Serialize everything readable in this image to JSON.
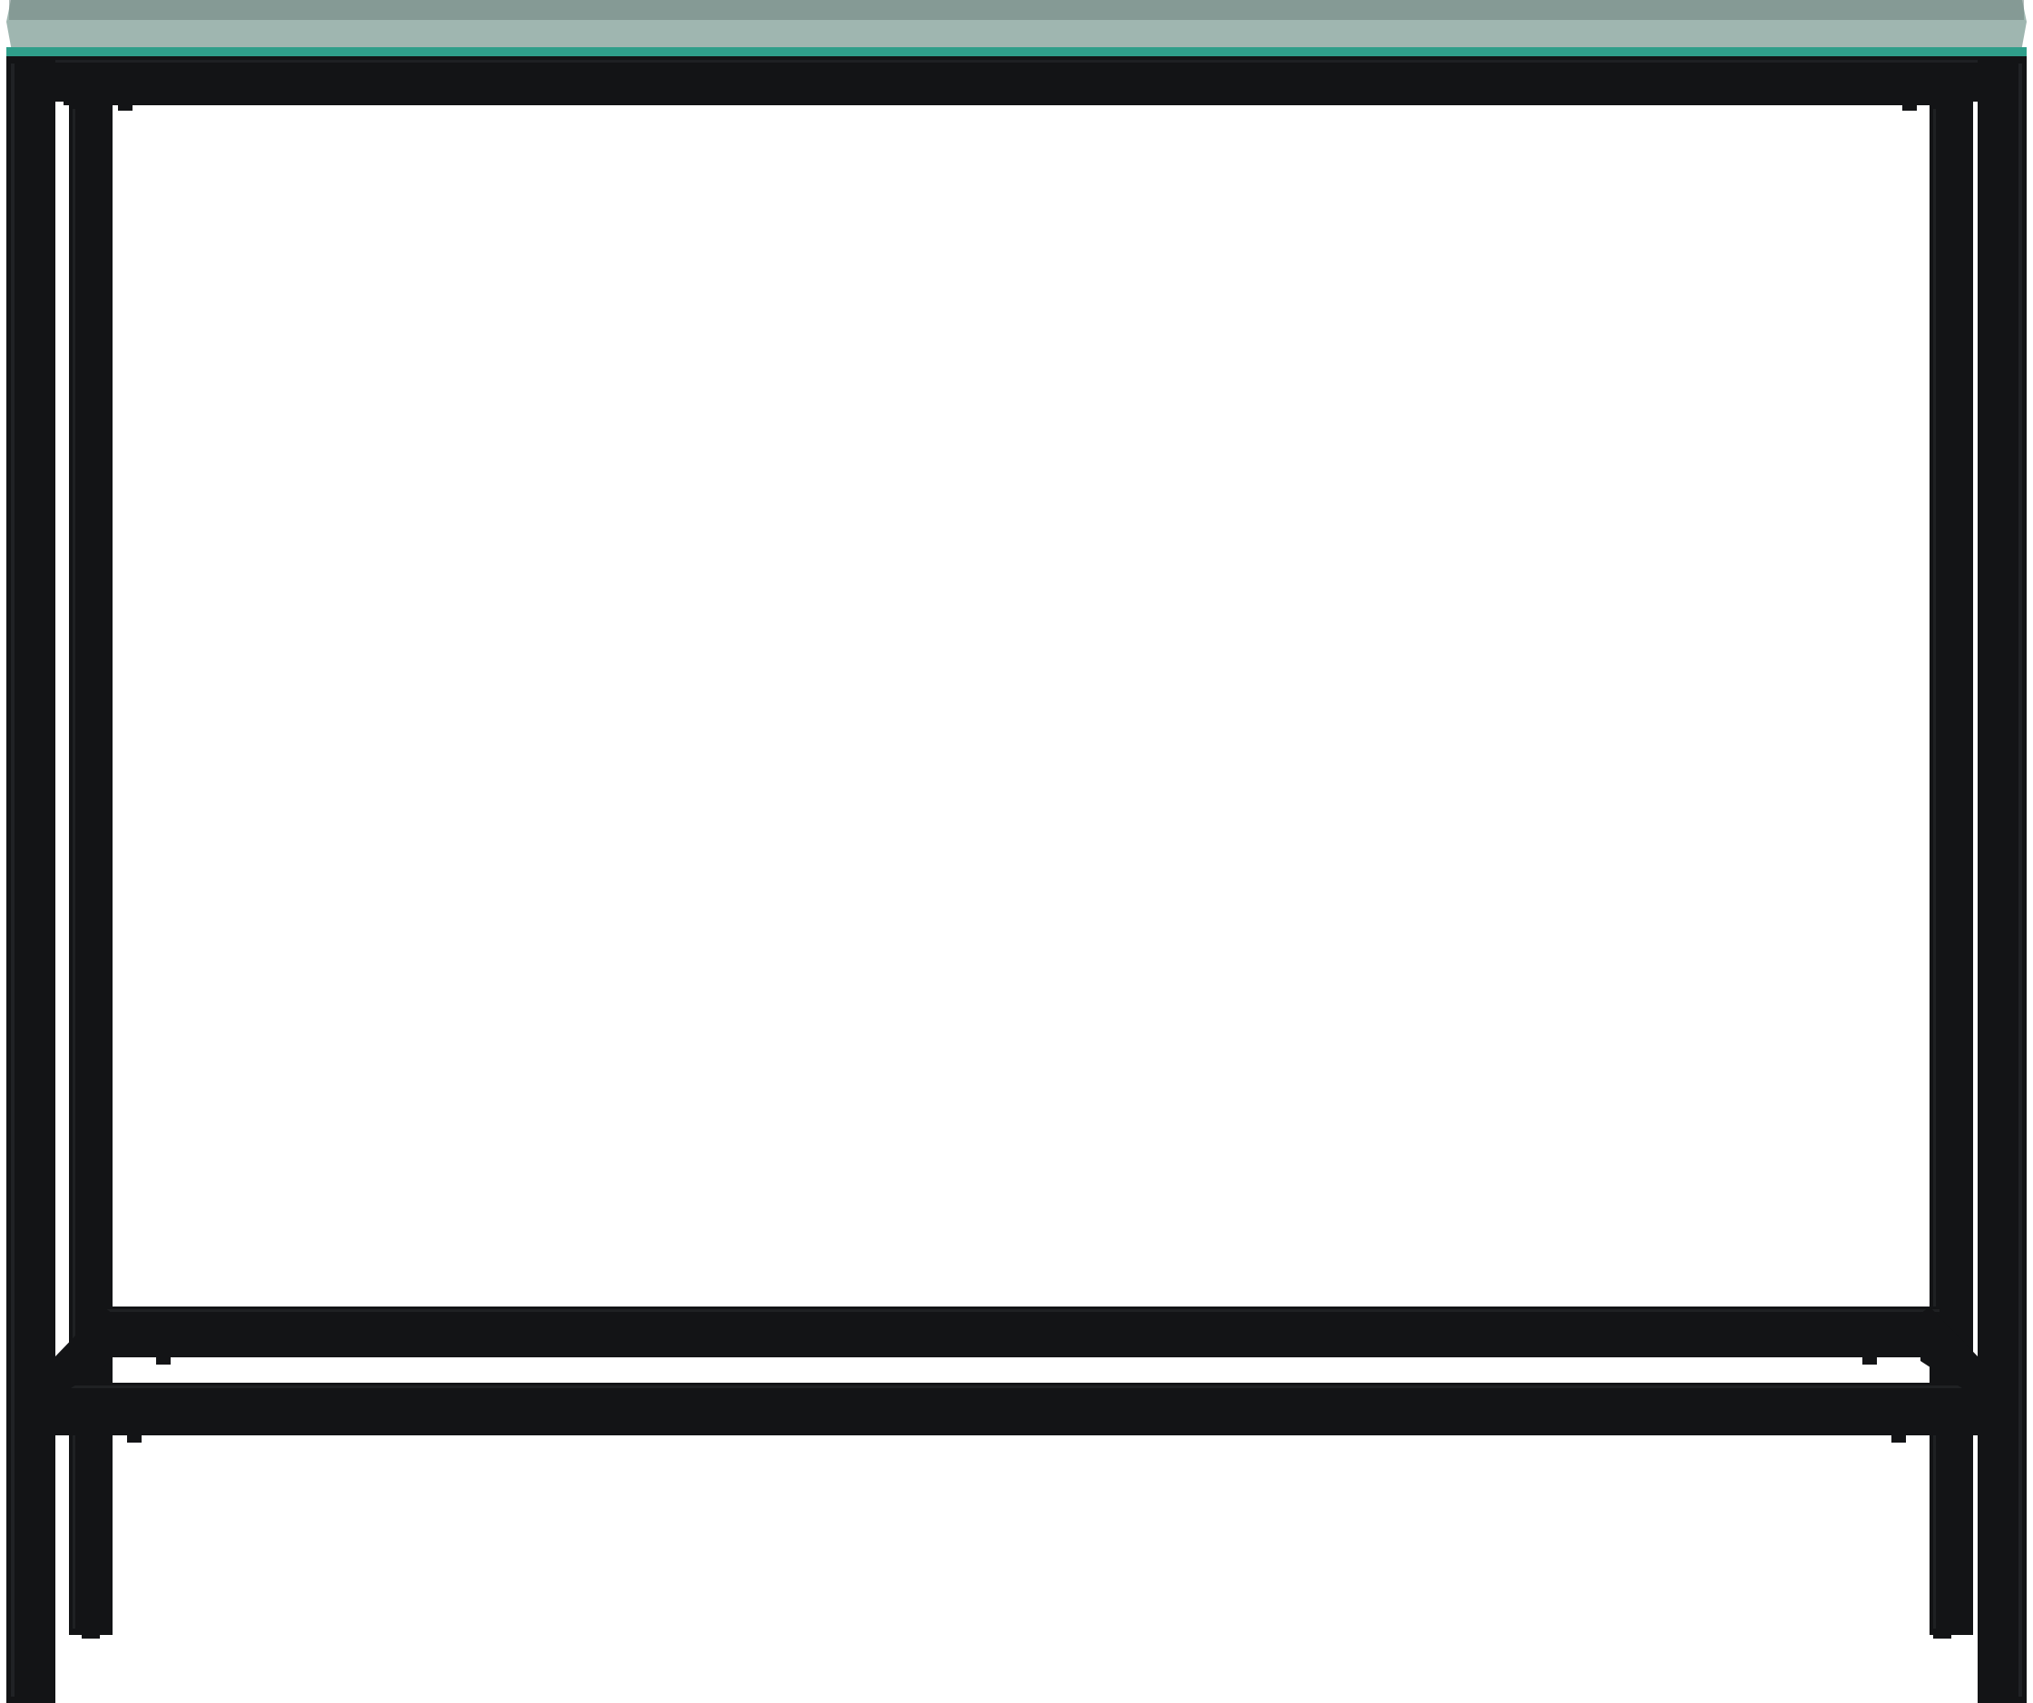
{
  "image": {
    "subject": "console-table",
    "background_color": "#ffffff"
  },
  "table": {
    "frame_color": "#131416",
    "frame_highlight_color": "#2a2c30",
    "glass_top_color": "#9fb6b0",
    "glass_edge_color": "#2f9e8a",
    "glass_shadow_color": "#6f8480"
  }
}
